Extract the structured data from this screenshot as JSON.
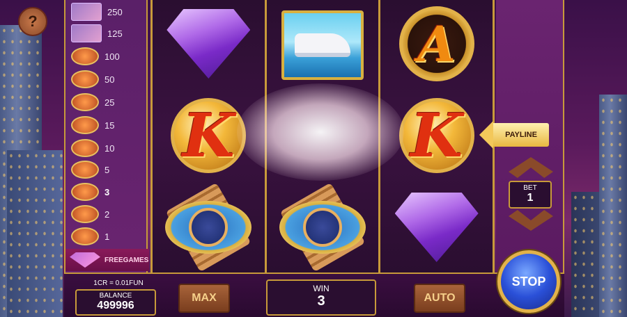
{
  "paytable": {
    "rows": [
      {
        "value": "250",
        "icon": "yacht-card-icon"
      },
      {
        "value": "125",
        "icon": "car-card-icon"
      },
      {
        "value": "100",
        "icon": "watch-coin-icon"
      },
      {
        "value": "50",
        "icon": "diamond-coin-icon"
      },
      {
        "value": "25",
        "icon": "ring-coin-icon"
      },
      {
        "value": "15",
        "icon": "a-coin-icon"
      },
      {
        "value": "10",
        "icon": "q-coin-icon"
      },
      {
        "value": "5",
        "icon": "j-coin-icon"
      },
      {
        "value": "3",
        "icon": "k-coin-icon",
        "active": true
      },
      {
        "value": "2",
        "icon": "q-coin-icon"
      },
      {
        "value": "1",
        "icon": "10-coin-icon"
      }
    ],
    "freegames_label": "FREEGAMES"
  },
  "reels": [
    [
      "diamond",
      "K",
      "watch"
    ],
    [
      "yacht",
      "sparkle",
      "watch"
    ],
    [
      "A",
      "K",
      "diamond"
    ]
  ],
  "symbols": {
    "k_letter": "K",
    "a_letter": "A"
  },
  "help": {
    "label": "?"
  },
  "payline": {
    "label": "PAYLINE"
  },
  "bet": {
    "title": "BET",
    "value": "1"
  },
  "credit": {
    "rate": "1CR = 0.01FUN"
  },
  "balance": {
    "title": "BALANCE",
    "value": "499996"
  },
  "buttons": {
    "max": "MAX",
    "auto": "AUTO",
    "stop": "STOP"
  },
  "win": {
    "title": "WIN",
    "value": "3"
  },
  "colors": {
    "gold": "#c89a3a",
    "purple": "#5a1a60",
    "stop_blue": "#2a50d8"
  }
}
